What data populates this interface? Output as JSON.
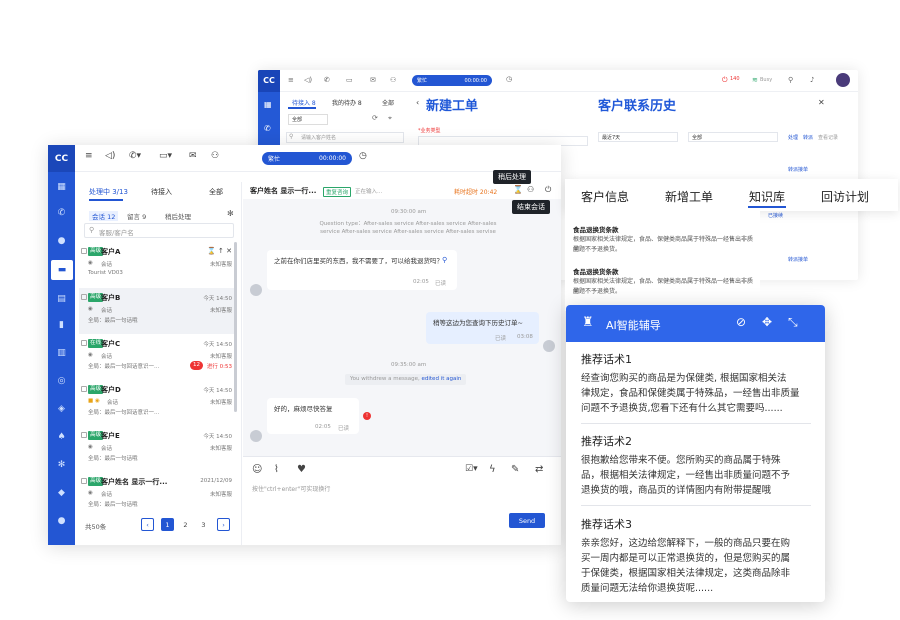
{
  "back_window": {
    "logo": "CC",
    "status": "繁忙",
    "timer": "00:00:00",
    "tabs": [
      "待接入 8",
      "我的待办 8",
      "全部"
    ],
    "panel_title_new_ticket": "新建工单",
    "panel_title_history": "客户联系历史",
    "search_placeholder": "请输入客户姓名",
    "filter_label": "全部",
    "recent_label": "最近7天",
    "top_badge": "140",
    "mini_text_1": "Busy",
    "field_label": "*业务类型",
    "link_text_1": "处理",
    "link_text_2": "转派",
    "link_text_3": "查看记录",
    "side_note": "转派接单",
    "side_note_2": "已接续",
    "side_note_3": "转派接单"
  },
  "main_window": {
    "logo": "CC",
    "status": "繁忙",
    "timer": "00:00:00",
    "list_tabs": [
      "处理中 3/13",
      "待接入",
      "全部"
    ],
    "sub_tabs": [
      "会话 12",
      "留言 9",
      "稍后处理"
    ],
    "search_placeholder": "客服/客户名",
    "customers": [
      {
        "tag": "高级",
        "name": "客户A",
        "channel": "会话",
        "desc": "Tourist VD03",
        "time": "",
        "status": "未知客服",
        "badge": ""
      },
      {
        "tag": "高级",
        "name": "客户B",
        "channel": "会话",
        "desc": "全局：最后一句话哦",
        "time": "今天 14:50",
        "status": "未知客服",
        "badge": ""
      },
      {
        "tag": "在线",
        "name": "客户C",
        "channel": "会话",
        "desc": "全局：最后一句回话意识一...",
        "time": "今天 14:50",
        "status": "未知客服",
        "badge": "12",
        "timer": "进行 0:53"
      },
      {
        "tag": "高级",
        "name": "客户D",
        "channel": "会话",
        "desc": "全局：最后一句回话意识一...",
        "time": "今天 14:50",
        "status": "未知客服",
        "badge": ""
      },
      {
        "tag": "高级",
        "name": "客户E",
        "channel": "会话",
        "desc": "全局：最后一句话哦",
        "time": "今天 14:50",
        "status": "未知客服",
        "badge": ""
      },
      {
        "tag": "高级",
        "name": "客户姓名 显示一行...",
        "channel": "会话",
        "desc": "全局：最后一句话哦",
        "time": "2021/12/09",
        "status": "未知客服",
        "badge": ""
      }
    ],
    "total": "共50条",
    "pages": [
      "1",
      "2",
      "3"
    ],
    "chat": {
      "header_name": "客户姓名 显示一行...",
      "header_tag": "重复咨询",
      "header_status": "正在输入...",
      "header_timer": "耗时超时 20:42",
      "tooltip_later": "稍后处理",
      "tooltip_end": "结束会话",
      "time_1": "09:30:00 am",
      "system_note": "Question type：After-sales service After-sales service After-sales service After-sales service After-sales service After-sales servise",
      "msg_1": "之前在你们店里买的东西，我不需要了，可以给我退货吗？",
      "msg_1_time": "02:05",
      "msg_1_read": "已读",
      "msg_2": "稍等这边为您查询下历史订单~",
      "msg_2_read": "已读",
      "msg_2_time": "03:08",
      "time_2": "09:35:00 am",
      "withdraw_note": "You withdrew a message,",
      "withdraw_link": "edited it again",
      "msg_3": "好的，麻烦尽快答复",
      "msg_3_time": "02:05",
      "msg_3_read": "已读",
      "composer_placeholder": "按住\"ctrl+enter\"可实现换行",
      "send_label": "Send"
    }
  },
  "info_panel": {
    "tabs": [
      "客户信息",
      "新增工单",
      "知识库",
      "回访计划"
    ],
    "active_tab": "知识库",
    "kb_items": [
      {
        "title": "食品退换货条款",
        "text_1": "根据国家相关法律规定，食品、保健类商品属于特殊品一经售出非质量",
        "text_2": "问题不予退换货。"
      },
      {
        "title": "食品退换货条款",
        "text_1": "根据国家相关法律规定，食品、保健类商品属于特殊品一经售出非质量",
        "text_2": "问题不予退换货。"
      }
    ],
    "highlight_word": "退换货"
  },
  "ai_panel": {
    "title": "AI智能辅导",
    "sections": [
      {
        "title": "推荐话术1",
        "lines": [
          "经查询您购买的商品是为保健类, 根据国家相关法",
          "律规定，食品和保健类属于特殊品，一经售出非质量",
          "问题不予退换货,您看下还有什么其它需要吗......"
        ]
      },
      {
        "title": "推荐话术2",
        "lines": [
          "很抱歉给您带来不便。您所购买的商品属于特殊",
          "品，根据相关法律规定，一经售出非质量问题不予",
          "退换货的哦，商品页的详情图内有附带提醒哦"
        ]
      },
      {
        "title": "推荐话术3",
        "lines": [
          "亲亲您好，这边给您解释下，一般的商品只要在购",
          "买一周内都是可以正常退换货的，但是您购买的属",
          "于保健类，根据国家相关法律规定，这类商品除非",
          "质量问题无法给你退换货呢......"
        ]
      }
    ]
  }
}
